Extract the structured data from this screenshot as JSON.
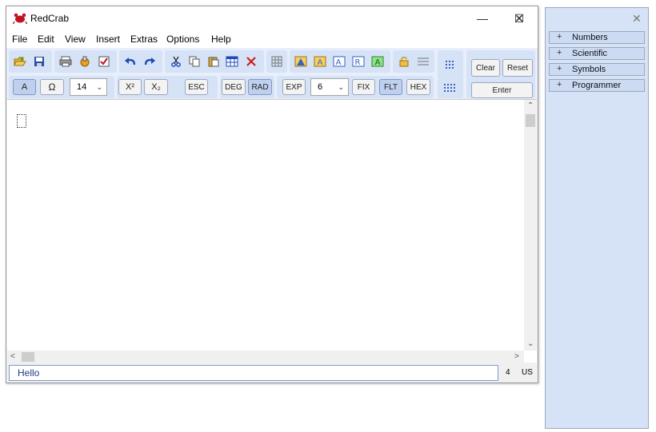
{
  "window": {
    "title": "RedCrab",
    "controls": {
      "minimize": "—",
      "maximize": "☐",
      "close": "✕"
    }
  },
  "menu": [
    "File",
    "Edit",
    "View",
    "Insert",
    "Extras",
    "Options",
    "Help"
  ],
  "toolbar": {
    "row1_icons": [
      "open-icon",
      "save-icon",
      "print-icon",
      "print-setup-icon",
      "check-icon",
      "undo-icon",
      "redo-icon",
      "cut-icon",
      "copy-icon",
      "paste-icon",
      "table-icon",
      "delete-icon",
      "grid-icon",
      "chart-a-icon",
      "chart-b-icon",
      "chart-c-icon",
      "chart-r-icon",
      "chart-g-icon",
      "lock-icon",
      "lines-icon"
    ],
    "font_button": "A",
    "symbol_button": "Ω",
    "font_size": "14",
    "superscript": "X²",
    "subscript": "X₂",
    "esc": "ESC",
    "deg": "DEG",
    "rad": "RAD",
    "exp": "EXP",
    "precision": "6",
    "fix": "FIX",
    "flt": "FLT",
    "hex": "HEX",
    "clear": "Clear",
    "reset": "Reset",
    "enter": "Enter",
    "active_buttons": [
      "A",
      "RAD",
      "FLT"
    ],
    "accent_color": "#bfd0ee"
  },
  "status": {
    "input_text": "Hello",
    "count": "4",
    "locale": "US"
  },
  "side_panel": {
    "close_label": "✕",
    "items": [
      {
        "expander": "+",
        "label": "Numbers"
      },
      {
        "expander": "+",
        "label": "Scientific"
      },
      {
        "expander": "+",
        "label": "Symbols"
      },
      {
        "expander": "+",
        "label": "Programmer"
      }
    ]
  }
}
